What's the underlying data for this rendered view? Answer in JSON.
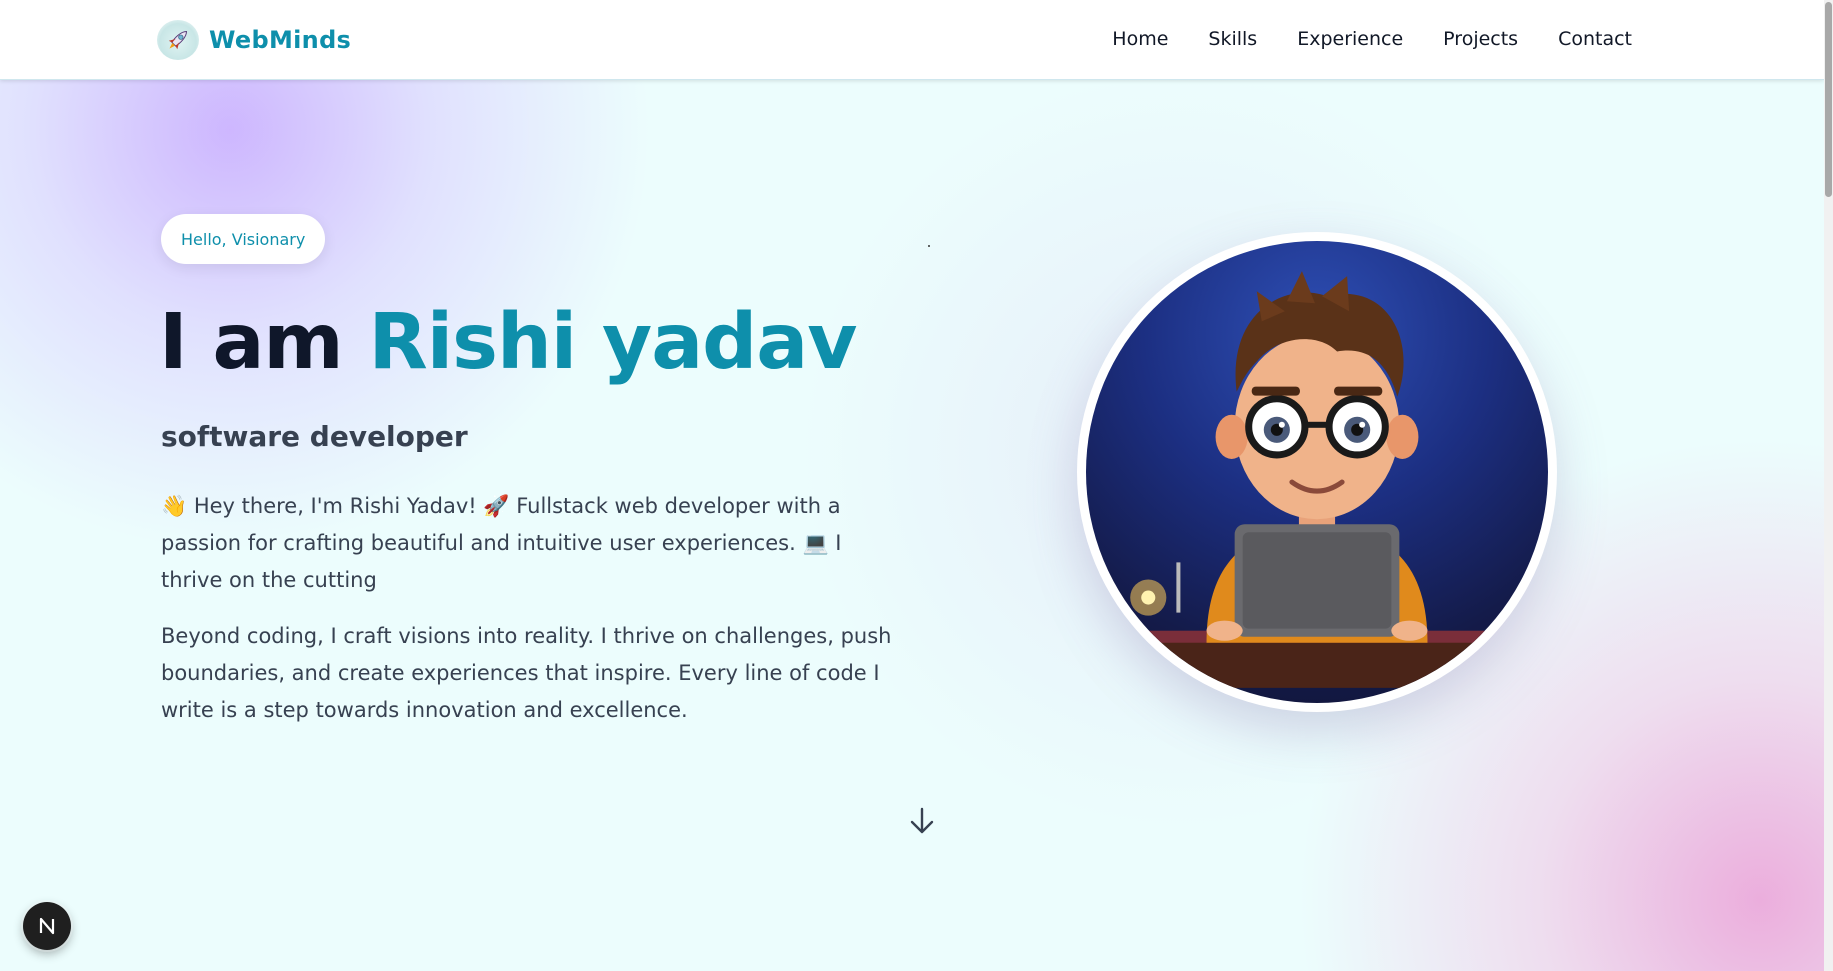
{
  "navbar": {
    "brand_name": "WebMinds",
    "links": [
      {
        "label": "Home"
      },
      {
        "label": "Skills"
      },
      {
        "label": "Experience"
      },
      {
        "label": "Projects"
      },
      {
        "label": "Contact"
      }
    ]
  },
  "hero": {
    "badge": "Hello, Visionary",
    "headline_lead": "I am",
    "headline_name": "Rishi yadav",
    "subtitle": "software developer",
    "intro_parts": [
      "👋",
      " Hey there, I'm Rishi Yadav! ",
      "🚀",
      " Fullstack web developer with a passion for crafting beautiful and intuitive user experiences. ",
      "💻",
      " I thrive on the cutting"
    ],
    "paragraph2": "Beyond coding, I craft visions into reality. I thrive on challenges, push boundaries, and create experiences that inspire. Every line of code I write is a step towards innovation and excellence."
  },
  "icons": {
    "brand_logo": "rocket-logo-icon",
    "scroll": "arrow-down-icon",
    "dev_indicator": "nextjs-n-icon"
  },
  "colors": {
    "accent": "#0e8fab",
    "heading": "#0f172a",
    "body_text": "#374151",
    "background": "#ecfdfd"
  }
}
